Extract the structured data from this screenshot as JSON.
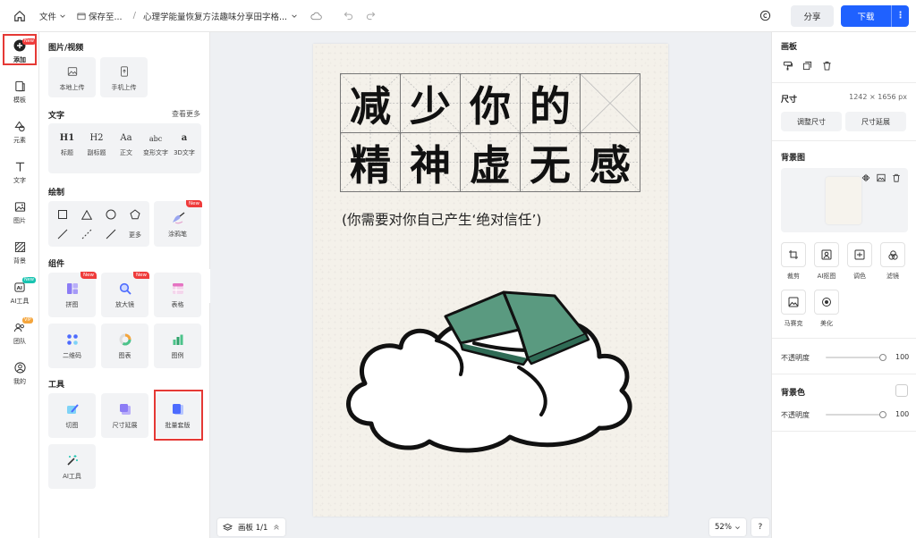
{
  "topbar": {
    "file_menu": "文件",
    "save_status": "保存至...",
    "separator": "/",
    "doc_title": "心理学能量恢复方法趣味分享田字格...",
    "share_label": "分享",
    "download_label": "下载"
  },
  "rail": {
    "items": [
      {
        "label": "添加",
        "icon": "plus-circle-icon"
      },
      {
        "label": "模板",
        "icon": "template-icon"
      },
      {
        "label": "元素",
        "icon": "shapes-icon"
      },
      {
        "label": "文字",
        "icon": "text-icon"
      },
      {
        "label": "图片",
        "icon": "image-icon"
      },
      {
        "label": "背景",
        "icon": "background-icon"
      },
      {
        "label": "AI工具",
        "icon": "ai-icon"
      },
      {
        "label": "团队",
        "icon": "team-icon"
      },
      {
        "label": "我的",
        "icon": "user-icon"
      }
    ],
    "badge_new": "New",
    "badge_vip": "VIP"
  },
  "panel": {
    "media_title": "图片/视频",
    "local_upload": "本地上传",
    "phone_upload": "手机上传",
    "text_title": "文字",
    "text_more": "查看更多",
    "text_options": [
      {
        "glyph": "H1",
        "label": "标题"
      },
      {
        "glyph": "H2",
        "label": "副标题"
      },
      {
        "glyph": "Aa",
        "label": "正文"
      },
      {
        "glyph": "abc",
        "label": "变形文字"
      },
      {
        "glyph": "a",
        "label": "3D文字"
      }
    ],
    "draw_title": "绘制",
    "draw_more": "更多",
    "brush_label": "涂鸦笔",
    "components_title": "组件",
    "components": [
      {
        "label": "拼图",
        "new": true
      },
      {
        "label": "放大镜",
        "new": true
      },
      {
        "label": "表格",
        "new": false
      },
      {
        "label": "二维码",
        "new": false
      },
      {
        "label": "图表",
        "new": false
      },
      {
        "label": "图例",
        "new": false
      }
    ],
    "tools_title": "工具",
    "tools": [
      {
        "label": "切图"
      },
      {
        "label": "尺寸延展"
      },
      {
        "label": "批量套版"
      },
      {
        "label": "AI工具"
      }
    ],
    "new_tag": "New"
  },
  "poster": {
    "row1": [
      "减",
      "少",
      "你",
      "的",
      ""
    ],
    "row2": [
      "精",
      "神",
      "虚",
      "无",
      "感"
    ],
    "subtitle": "(你需要对你自己产生‘绝对信任’)"
  },
  "canvas": {
    "page_indicator": "画板 1/1",
    "zoom": "52%",
    "help": "?"
  },
  "right": {
    "artboard_title": "画板",
    "size_title": "尺寸",
    "size_value": "1242 × 1656 px",
    "adjust_size": "调整尺寸",
    "extend_size": "尺寸延展",
    "bg_image_title": "背景图",
    "tools": [
      {
        "label": "裁剪",
        "icon": "crop-icon"
      },
      {
        "label": "AI抠图",
        "icon": "ai-cutout-icon"
      },
      {
        "label": "调色",
        "icon": "adjust-color-icon"
      },
      {
        "label": "滤镜",
        "icon": "filter-icon"
      },
      {
        "label": "马赛克",
        "icon": "mosaic-icon"
      },
      {
        "label": "美化",
        "icon": "beautify-icon"
      }
    ],
    "opacity_label": "不透明度",
    "opacity_value": "100",
    "bg_color_title": "背景色",
    "opacity_label_2": "不透明度",
    "opacity_value_2": "100"
  },
  "colors": {
    "primary": "#1f61ff",
    "highlight": "#e53935",
    "book_green": "#5a9a80"
  }
}
